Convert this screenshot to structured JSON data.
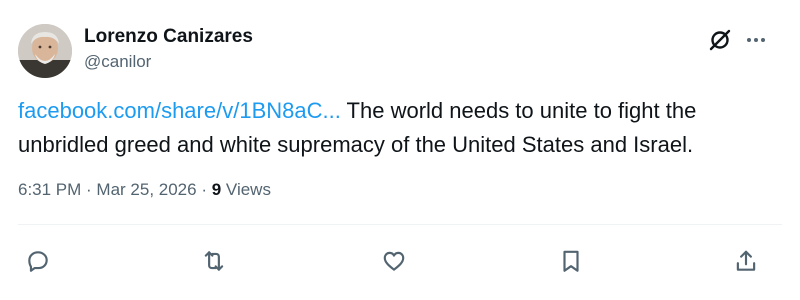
{
  "author": {
    "display_name": "Lorenzo Canizares",
    "handle": "@canilor"
  },
  "post": {
    "link_text": "facebook.com/share/v/1BN8aC...",
    "body": " The world needs to unite to fight the unbridled greed and white supremacy of the United States and Israel."
  },
  "meta": {
    "time": "6:31 PM",
    "sep1": " · ",
    "date": "Mar 25, 2026",
    "sep2": " · ",
    "views_count": "9",
    "views_label": " Views"
  },
  "icons": {
    "header": [
      "grok-icon",
      "more-icon"
    ],
    "actions": [
      "reply-icon",
      "repost-icon",
      "like-icon",
      "bookmark-icon",
      "share-icon"
    ]
  },
  "colors": {
    "link": "#1d9bf0",
    "secondary_text": "#536471",
    "primary_text": "#0f1419"
  }
}
